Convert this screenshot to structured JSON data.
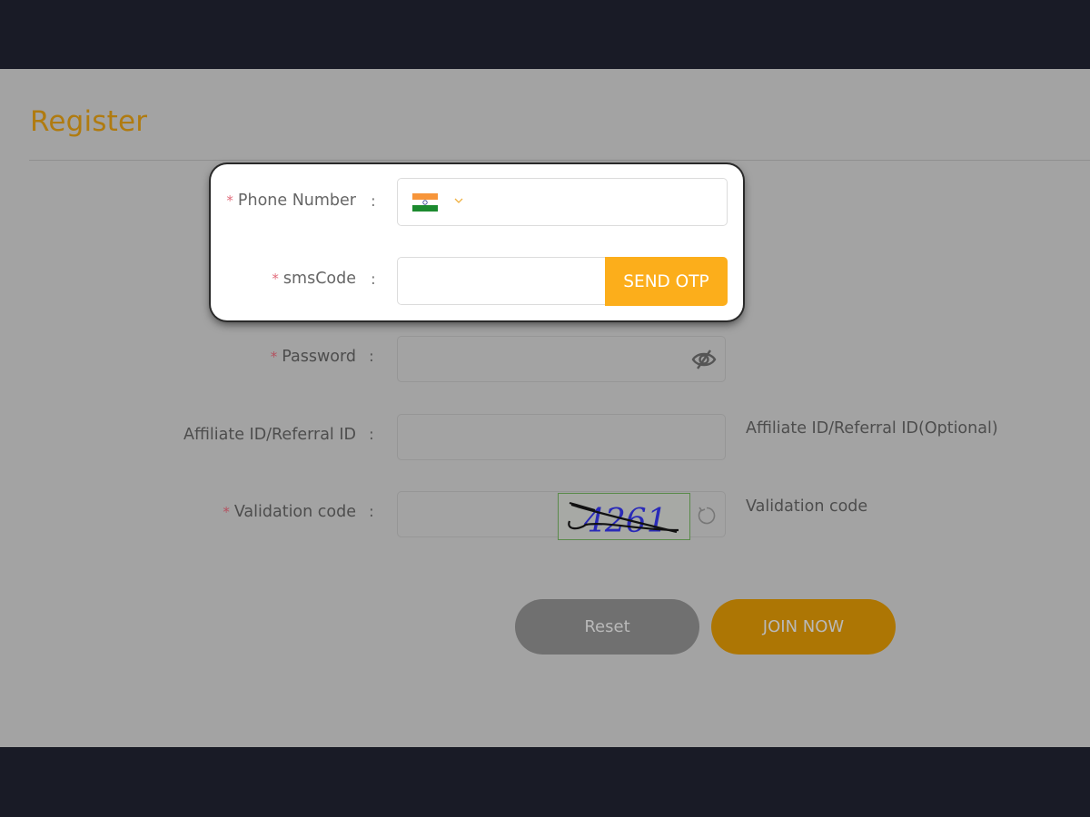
{
  "page": {
    "title": "Register"
  },
  "form": {
    "phone": {
      "required_mark": "*",
      "label": "Phone Number",
      "colon": ":",
      "country": "India",
      "flag_icon": "india-flag-icon",
      "value": ""
    },
    "sms": {
      "required_mark": "*",
      "label": "smsCode",
      "colon": ":",
      "value": "",
      "send_button": "SEND OTP"
    },
    "password": {
      "required_mark": "*",
      "label": "Password",
      "colon": ":",
      "value": "",
      "toggle_icon": "eye-slash-icon"
    },
    "affiliate": {
      "label": "Affiliate ID/Referral ID",
      "colon": ":",
      "value": "",
      "hint": "Affiliate ID/Referral ID(Optional)"
    },
    "validation": {
      "required_mark": "*",
      "label": "Validation code",
      "colon": ":",
      "value": "",
      "captcha_text": "4261",
      "hint": "Validation code",
      "refresh_icon": "refresh-icon"
    }
  },
  "buttons": {
    "reset": "Reset",
    "join": "JOIN NOW"
  },
  "colors": {
    "accent": "#fcae1b",
    "title": "#b07b10",
    "bars": "#191b26"
  }
}
